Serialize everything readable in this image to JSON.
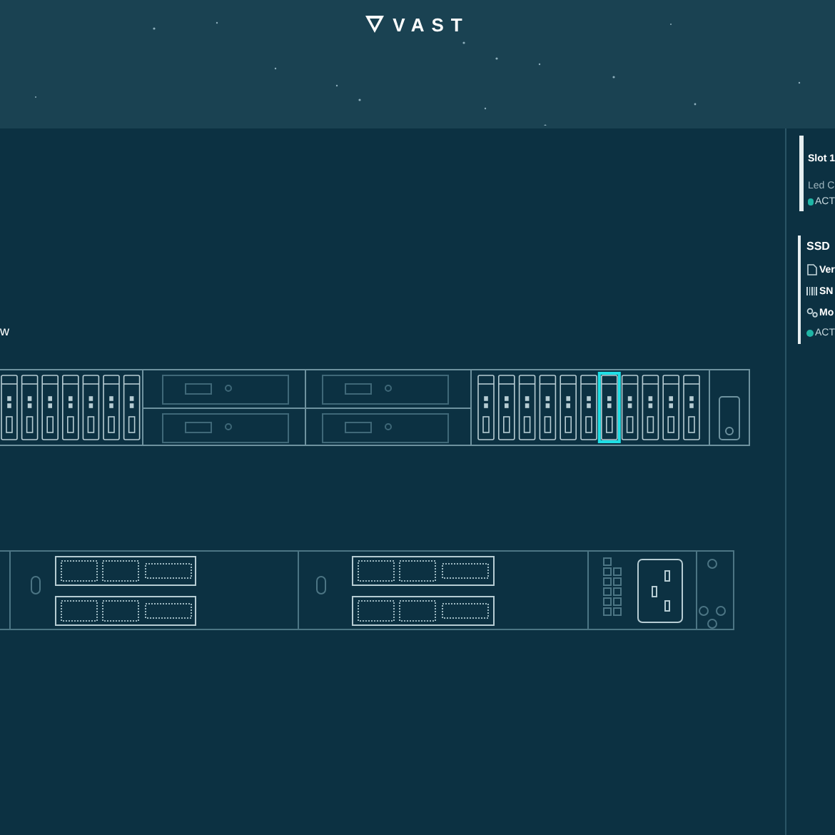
{
  "logo": {
    "text": "VAST"
  },
  "front_label": "w",
  "front_panel": {
    "left_drives": [
      {
        "selected": false
      },
      {
        "selected": false
      },
      {
        "selected": false
      },
      {
        "selected": false
      },
      {
        "selected": false
      },
      {
        "selected": false
      },
      {
        "selected": false
      }
    ],
    "right_drives": [
      {
        "selected": false
      },
      {
        "selected": false
      },
      {
        "selected": false
      },
      {
        "selected": false
      },
      {
        "selected": false
      },
      {
        "selected": false
      },
      {
        "selected": true
      },
      {
        "selected": false
      },
      {
        "selected": false
      },
      {
        "selected": false
      },
      {
        "selected": false
      }
    ]
  },
  "side_panel": {
    "slot": {
      "title": "Slot 1",
      "led": "Led C",
      "status": "ACT"
    },
    "ssd": {
      "title": "SSD",
      "rows": [
        {
          "kind": "document",
          "text": "Ver"
        },
        {
          "kind": "barcode",
          "text": "SN"
        },
        {
          "kind": "gears",
          "text": "Mo"
        }
      ],
      "status": "ACT"
    }
  }
}
